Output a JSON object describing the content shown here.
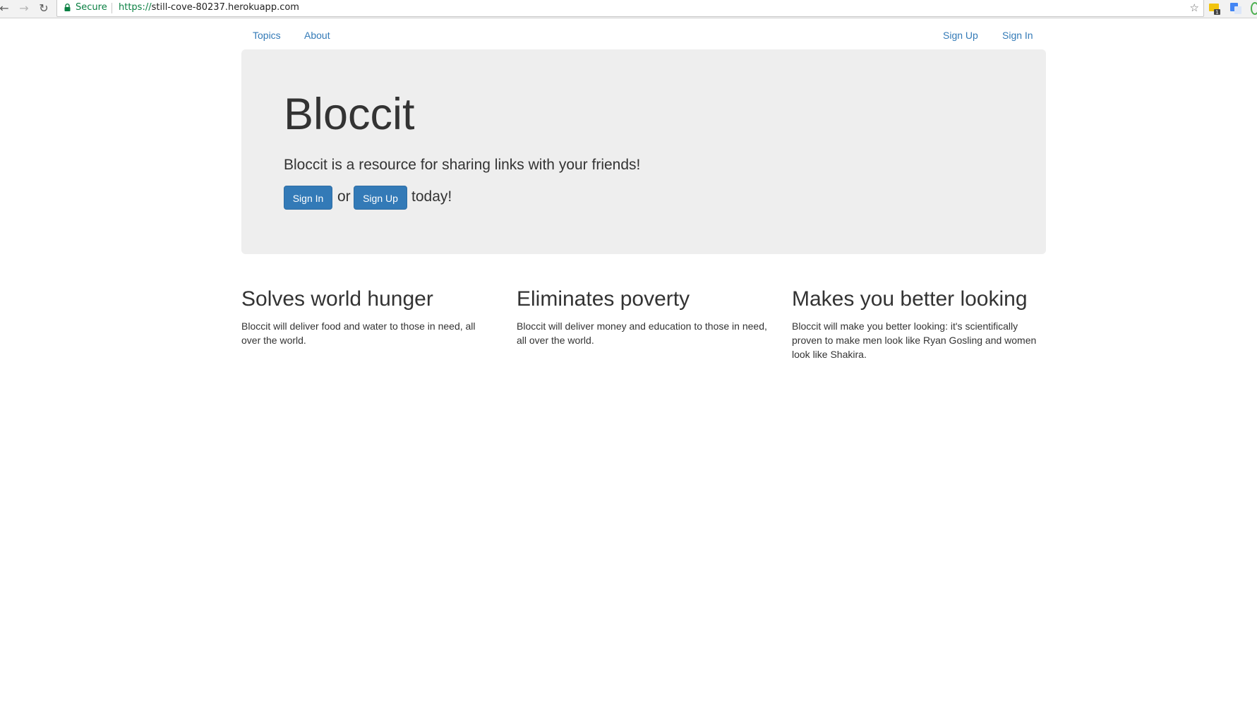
{
  "browser": {
    "secure_label": "Secure",
    "url_scheme": "https://",
    "url_host": "still-cove-80237.herokuapp.com",
    "ext_badge": "1",
    "icons": [
      "back-icon",
      "forward-icon",
      "reload-icon",
      "lock-icon",
      "star-icon",
      "extension-icon",
      "translate-icon"
    ]
  },
  "navbar": {
    "topics": "Topics",
    "about": "About",
    "sign_up": "Sign Up",
    "sign_in": "Sign In"
  },
  "jumbotron": {
    "title": "Bloccit",
    "lead": "Bloccit is a resource for sharing links with your friends!",
    "sign_in_button": "Sign In",
    "or_text": "or",
    "sign_up_button": "Sign Up",
    "today_text": "today!"
  },
  "features": [
    {
      "title": "Solves world hunger",
      "text": "Bloccit will deliver food and water to those in need, all over the world."
    },
    {
      "title": "Eliminates poverty",
      "text": "Bloccit will deliver money and education to those in need, all over the world."
    },
    {
      "title": "Makes you better looking",
      "text": "Bloccit will make you better looking: it's scientifically proven to make men look like Ryan Gosling and women look like Shakira."
    }
  ],
  "colors": {
    "link": "#337ab7",
    "button": "#337ab7",
    "jumbotron_bg": "#eeeeee",
    "secure_green": "#0b8043"
  }
}
